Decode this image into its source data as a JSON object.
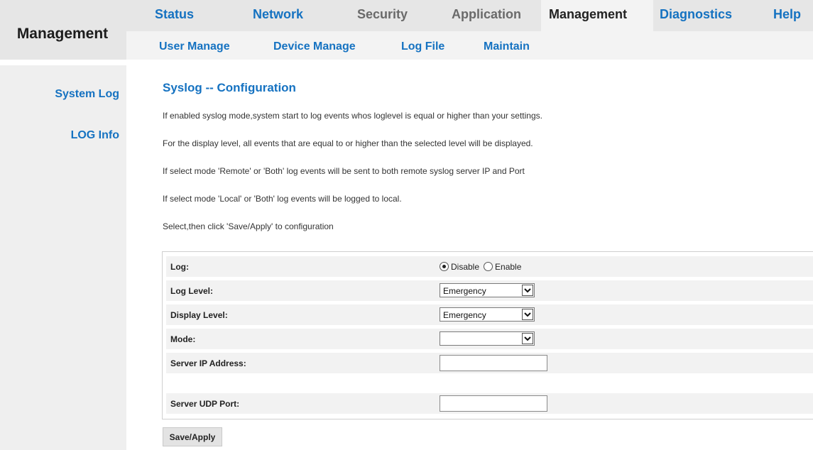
{
  "header": {
    "section_title": "Management",
    "main_tabs": [
      {
        "label": "Status",
        "state": "link"
      },
      {
        "label": "Network",
        "state": "link"
      },
      {
        "label": "Security",
        "state": "muted"
      },
      {
        "label": "Application",
        "state": "muted"
      },
      {
        "label": "Management",
        "state": "active"
      },
      {
        "label": "Diagnostics",
        "state": "link"
      },
      {
        "label": "Help",
        "state": "link"
      }
    ],
    "sub_tabs": [
      {
        "label": "User Manage"
      },
      {
        "label": "Device Manage"
      },
      {
        "label": "Log File"
      },
      {
        "label": "Maintain"
      }
    ]
  },
  "sidebar": {
    "items": [
      {
        "label": "System Log"
      },
      {
        "label": "LOG Info"
      }
    ]
  },
  "content": {
    "title": "Syslog -- Configuration",
    "descriptions": [
      "If enabled syslog mode,system start to log events whos loglevel is equal or higher than your settings.",
      "For the display level, all events that are equal to or higher than the selected level will be displayed.",
      "If select mode 'Remote' or 'Both' log events will be sent to both remote syslog server IP and Port",
      "If select mode 'Local' or 'Both' log events will be logged to local.",
      "Select,then click 'Save/Apply' to configuration"
    ]
  },
  "form": {
    "log": {
      "label": "Log:",
      "options": [
        "Disable",
        "Enable"
      ],
      "selected": "Disable"
    },
    "log_level": {
      "label": "Log Level:",
      "value": "Emergency"
    },
    "display_level": {
      "label": "Display Level:",
      "value": "Emergency"
    },
    "mode": {
      "label": "Mode:",
      "value": ""
    },
    "server_ip": {
      "label": "Server IP Address:",
      "value": ""
    },
    "server_port": {
      "label": "Server UDP Port:",
      "value": ""
    }
  },
  "actions": {
    "save_label": "Save/Apply"
  },
  "colors": {
    "link_blue": "#1572c1",
    "header_gray": "#e6e6e6",
    "row_gray": "#f2f2f2"
  }
}
